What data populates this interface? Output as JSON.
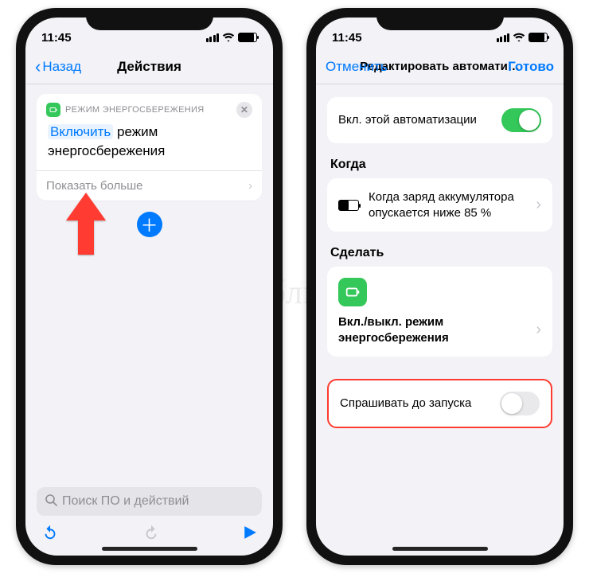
{
  "status": {
    "time": "11:45"
  },
  "left": {
    "nav": {
      "back": "Назад",
      "title": "Действия"
    },
    "card": {
      "app_label": "РЕЖИМ ЭНЕРГОСБЕРЕЖЕНИЯ",
      "token": "Включить",
      "rest1": "режим",
      "rest2": "энергосбережения",
      "show_more": "Показать больше"
    },
    "search_placeholder": "Поиск ПО и действий"
  },
  "right": {
    "nav": {
      "cancel": "Отменить",
      "title": "Редактировать автомати…",
      "done": "Готово"
    },
    "enable_row": "Вкл. этой автоматизации",
    "when_title": "Когда",
    "when_text": "Когда заряд аккумулятора опускается ниже 85 %",
    "do_title": "Сделать",
    "do_text": "Вкл./выкл. режим энергосбережения",
    "ask_text": "Спрашивать до запуска"
  },
  "watermark": "Яблык"
}
